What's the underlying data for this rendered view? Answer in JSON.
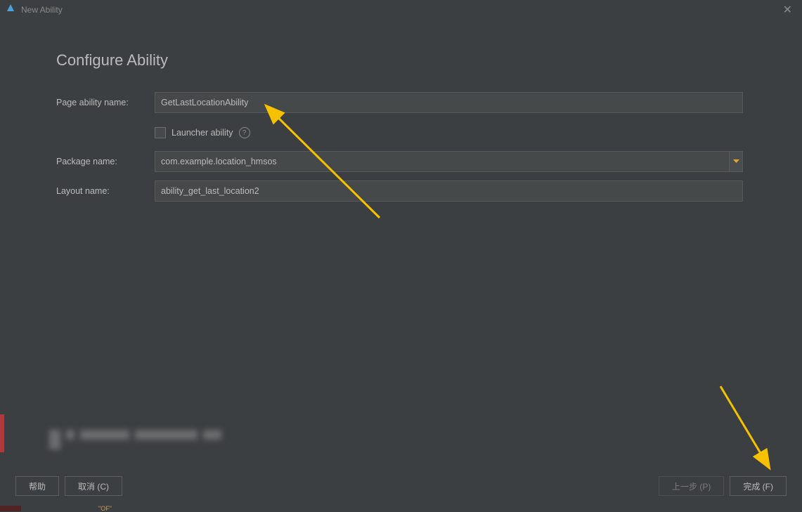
{
  "window": {
    "title": "New Ability"
  },
  "heading": "Configure Ability",
  "form": {
    "page_ability_label": "Page ability name:",
    "page_ability_value": "GetLastLocationAbility",
    "launcher_label": "Launcher ability",
    "package_label": "Package name:",
    "package_value": "com.example.location_hmsos",
    "layout_label": "Layout name:",
    "layout_value": "ability_get_last_location2"
  },
  "buttons": {
    "help": "帮助",
    "cancel": "取消 (C)",
    "previous": "上一步 (P)",
    "finish": "完成 (F)"
  },
  "bottom_strip_text": "\"OF\""
}
